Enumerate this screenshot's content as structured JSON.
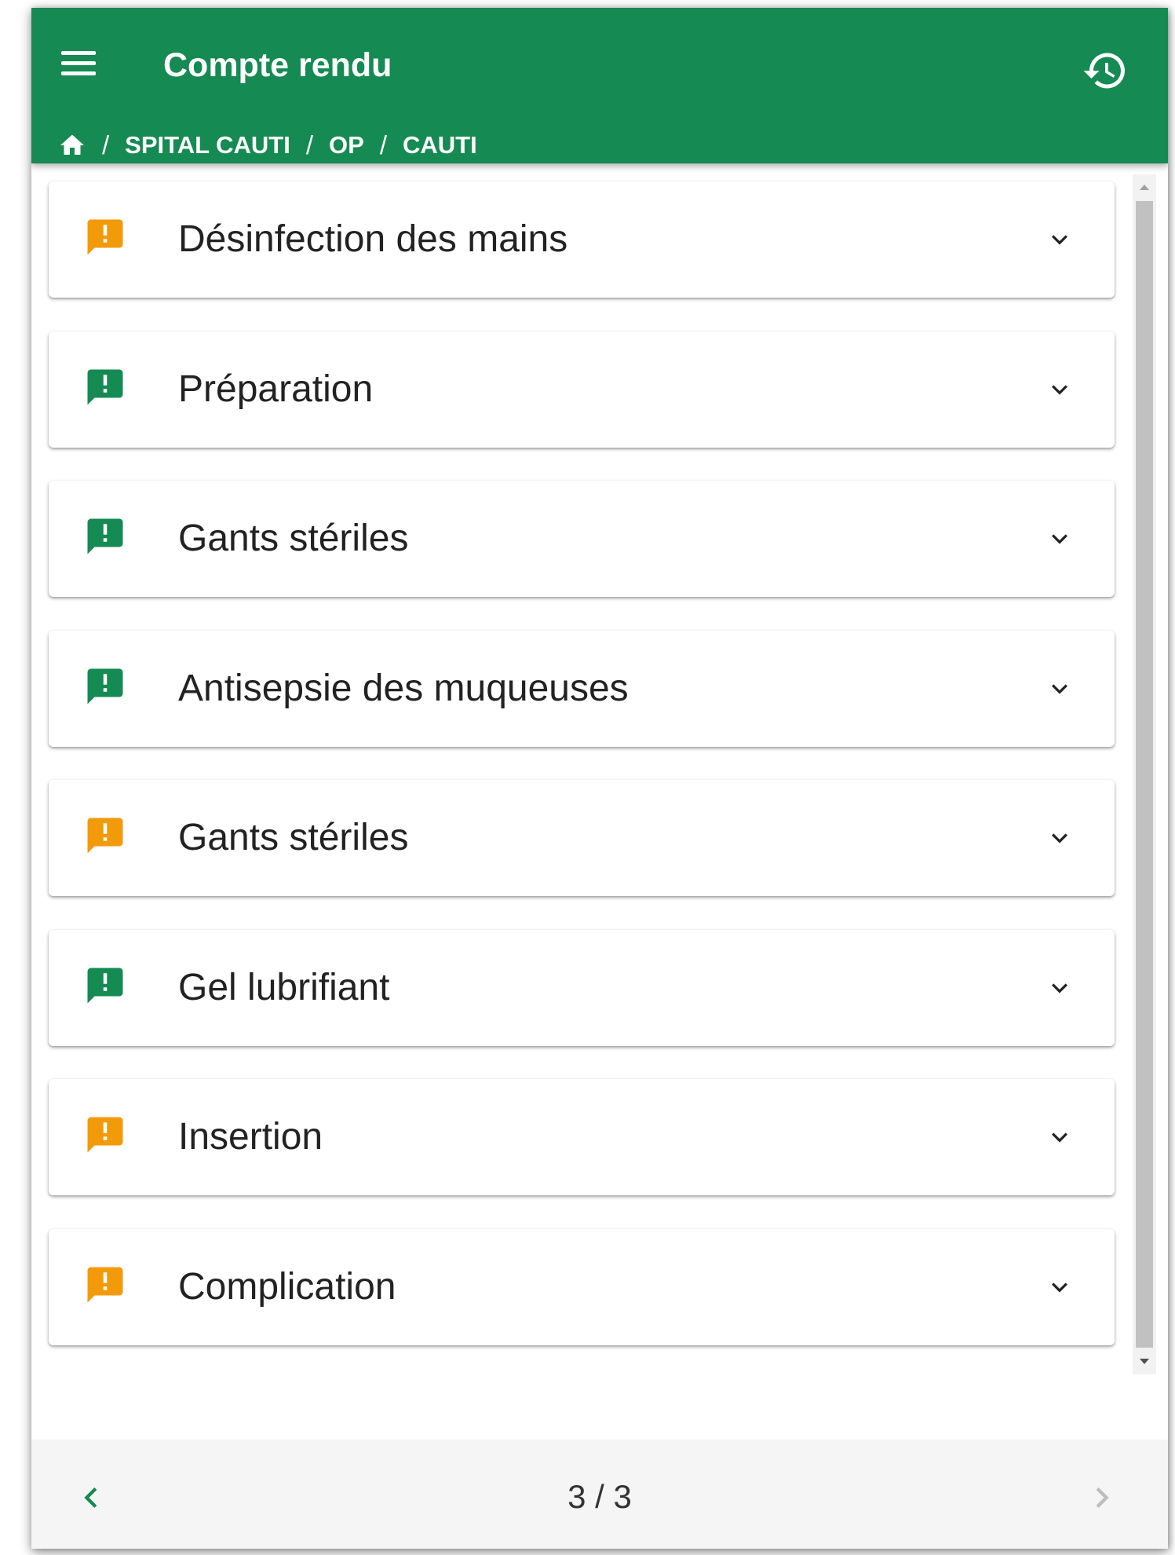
{
  "header": {
    "title": "Compte rendu",
    "breadcrumb": [
      "SPITAL CAUTI",
      "OP",
      "CAUTI"
    ],
    "separator": "/"
  },
  "colors": {
    "primary": "#158a53",
    "warning": "#f39a0b",
    "success": "#158a53"
  },
  "sections": [
    {
      "label": "Désinfection des mains",
      "status": "warning"
    },
    {
      "label": "Préparation",
      "status": "success"
    },
    {
      "label": "Gants stériles",
      "status": "success"
    },
    {
      "label": "Antisepsie des muqueuses",
      "status": "success"
    },
    {
      "label": "Gants stériles",
      "status": "warning"
    },
    {
      "label": "Gel lubrifiant",
      "status": "success"
    },
    {
      "label": "Insertion",
      "status": "warning"
    },
    {
      "label": "Complication",
      "status": "warning"
    }
  ],
  "icons": {
    "menu": "menu-icon",
    "history": "history-icon",
    "home": "home-icon",
    "status": "feedback-icon",
    "expand": "chevron-down-icon",
    "prev": "chevron-left-icon",
    "next": "chevron-right-icon"
  },
  "pagination": {
    "current": 3,
    "total": 3,
    "label": "3 / 3"
  }
}
